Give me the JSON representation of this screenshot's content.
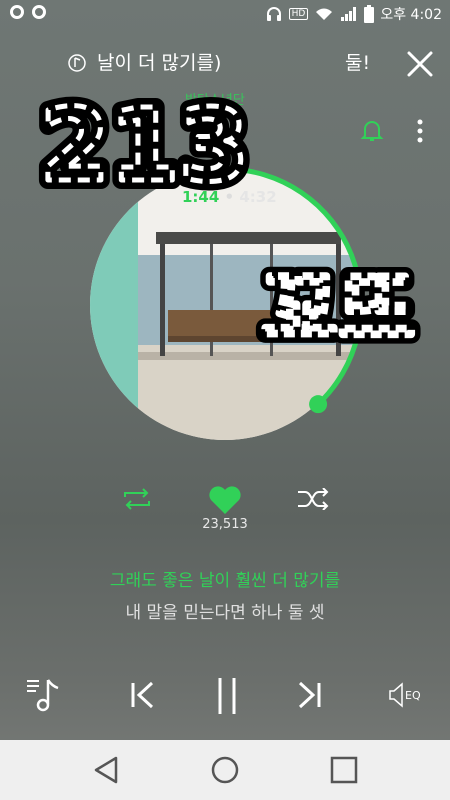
{
  "status_bar": {
    "time": "오후 4:02",
    "hd": "HD"
  },
  "player": {
    "song_title": "날이 더 많기를)",
    "song_title_next": "둘!",
    "artist": "방탄소년단",
    "elapsed": "1:44",
    "separator": "•",
    "duration": "4:32",
    "progress": 0.38,
    "like_count": "23,513"
  },
  "lyrics": {
    "current": "그래도 좋은 날이 훨씬 더 많기를",
    "next": "내 말을 믿는다면 하나 둘 셋"
  },
  "controls": {
    "eq_label": "EQ"
  },
  "overlay": {
    "text_top": "213",
    "text_right": "꾜뜨"
  },
  "colors": {
    "accent": "#31d158",
    "nav_bar": "#efefef"
  },
  "icons": [
    "music-note-icon",
    "bell-icon",
    "more-vert-icon",
    "close-icon",
    "repeat-icon",
    "heart-icon",
    "shuffle-icon",
    "playlist-icon",
    "prev-icon",
    "pause-icon",
    "next-icon",
    "eq-icon",
    "back-icon",
    "home-icon",
    "recents-icon"
  ]
}
